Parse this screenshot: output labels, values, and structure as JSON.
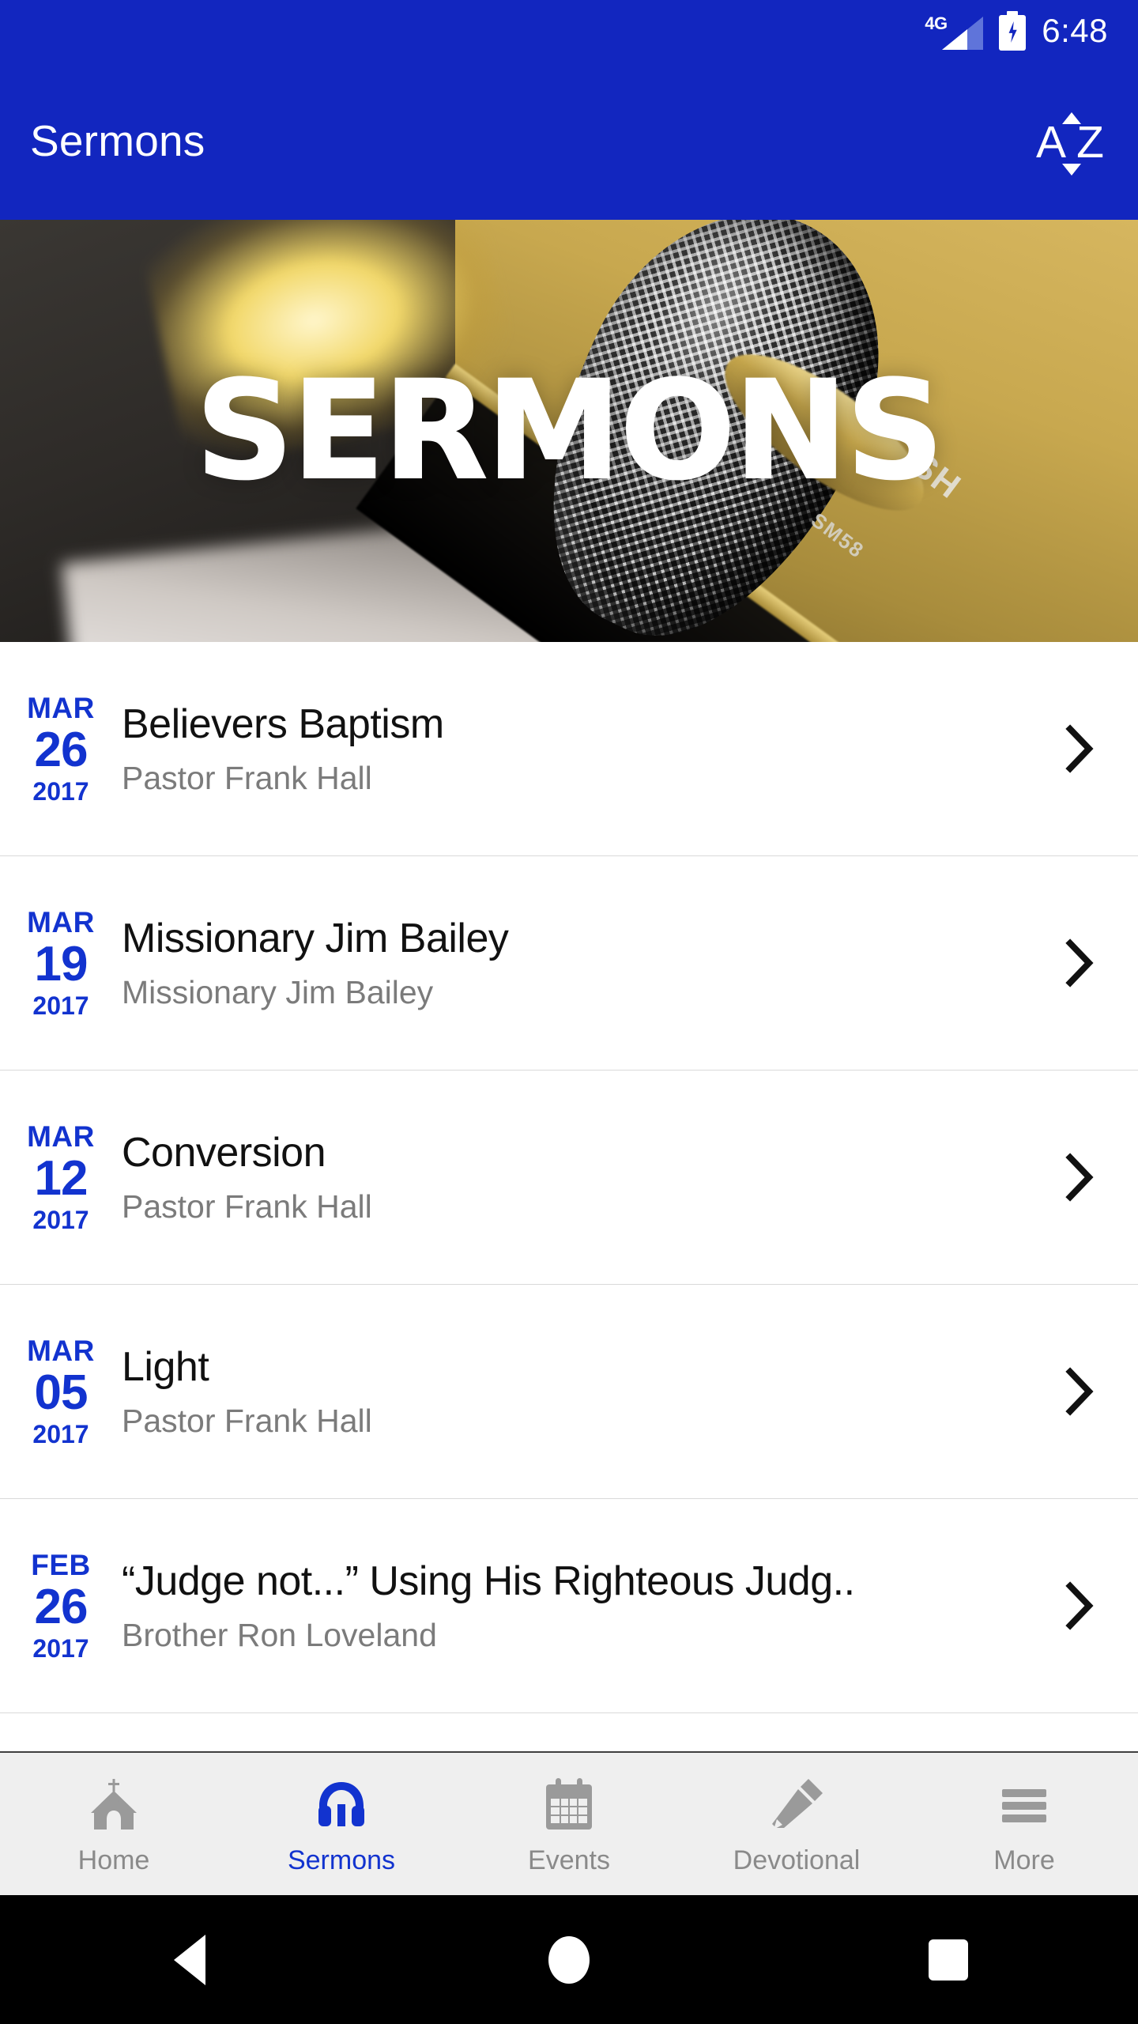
{
  "status_bar": {
    "network_label": "4G",
    "signal_icon": "signal-bars-icon",
    "battery_icon": "battery-charging-icon",
    "time": "6:48"
  },
  "app_bar": {
    "title": "Sermons",
    "sort_button": {
      "icon": "sort-alpha-icon",
      "letter_first": "A",
      "letter_last": "Z"
    },
    "background_color": "#1226bf"
  },
  "hero": {
    "overlay_text": "SERMONS",
    "mic_model_text": "SM58",
    "mic_brand_text": "SH",
    "image_description": "shure-sm58-microphone-photo"
  },
  "sermons": {
    "items": [
      {
        "month": "MAR",
        "day": "26",
        "year": "2017",
        "title": "Believers Baptism",
        "speaker": "Pastor Frank Hall",
        "chevron": "chevron-right-icon"
      },
      {
        "month": "MAR",
        "day": "19",
        "year": "2017",
        "title": "Missionary Jim Bailey",
        "speaker": "Missionary Jim Bailey",
        "chevron": "chevron-right-icon"
      },
      {
        "month": "MAR",
        "day": "12",
        "year": "2017",
        "title": "Conversion",
        "speaker": "Pastor Frank Hall",
        "chevron": "chevron-right-icon"
      },
      {
        "month": "MAR",
        "day": "05",
        "year": "2017",
        "title": "Light",
        "speaker": "Pastor Frank Hall",
        "chevron": "chevron-right-icon"
      },
      {
        "month": "FEB",
        "day": "26",
        "year": "2017",
        "title": "“Judge not...” Using His Righteous Judg..",
        "speaker": "Brother Ron Loveland",
        "chevron": "chevron-right-icon"
      }
    ],
    "date_color": "#1233cf",
    "title_color": "#111111",
    "speaker_color": "#7b7b7b",
    "divider_color": "#d9d9d9"
  },
  "tab_bar": {
    "active_color": "#1233cf",
    "inactive_color": "#8a8a8a",
    "background_color": "#efefef",
    "tabs": [
      {
        "label": "Home",
        "icon": "church-icon",
        "active": false
      },
      {
        "label": "Sermons",
        "icon": "headphones-icon",
        "active": true
      },
      {
        "label": "Events",
        "icon": "calendar-icon",
        "active": false
      },
      {
        "label": "Devotional",
        "icon": "pencil-icon",
        "active": false
      },
      {
        "label": "More",
        "icon": "hamburger-icon",
        "active": false
      }
    ]
  },
  "android_nav": {
    "back": "back-triangle-icon",
    "home": "home-circle-icon",
    "recents": "recents-square-icon"
  }
}
